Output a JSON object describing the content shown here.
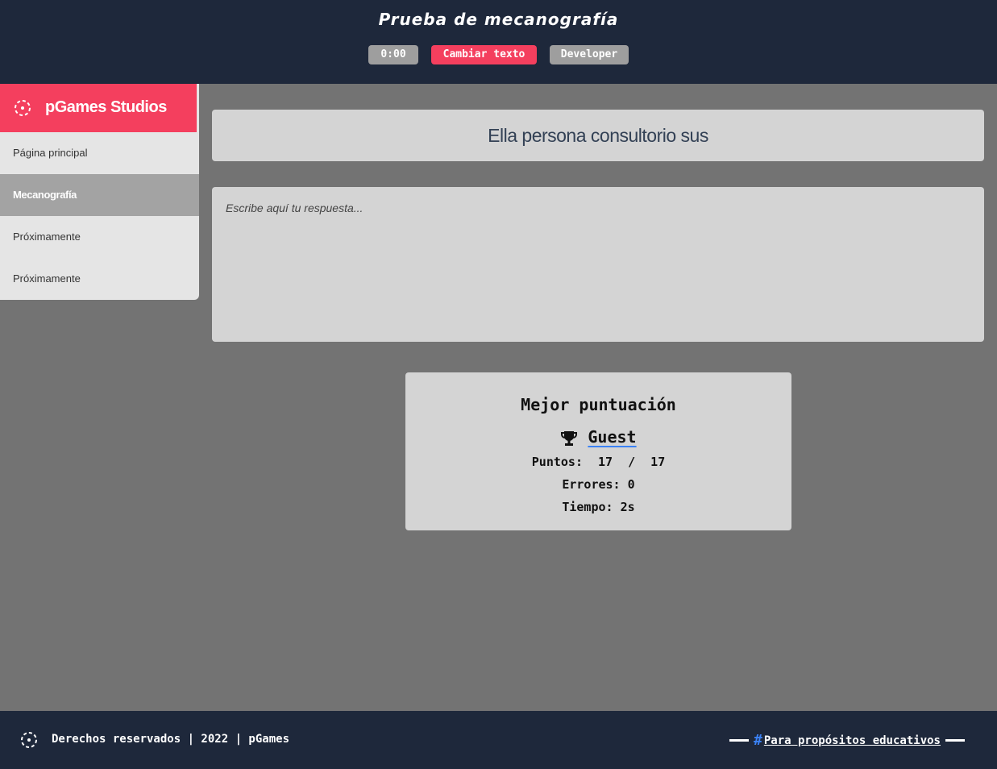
{
  "header": {
    "title": "Prueba de mecanografía",
    "timer": "0:00",
    "change_text_label": "Cambiar texto",
    "developer_label": "Developer"
  },
  "sidebar": {
    "brand": "pGames Studios",
    "items": [
      {
        "label": "Página principal",
        "active": false
      },
      {
        "label": "Mecanografía",
        "active": true
      },
      {
        "label": "Próximamente",
        "active": false
      },
      {
        "label": "Próximamente",
        "active": false
      }
    ]
  },
  "main": {
    "target_text": "Ella persona consultorio sus",
    "answer_placeholder": "Escribe aquí tu respuesta...",
    "answer_value": ""
  },
  "score": {
    "title": "Mejor puntuación",
    "user": "Guest",
    "points_label": "Puntos:",
    "points_value": "17",
    "points_sep": "/",
    "points_total": "17",
    "errors_label": "Errores:",
    "errors_value": "0",
    "time_label": "Tiempo:",
    "time_value": "2s"
  },
  "footer": {
    "copyright": "Derechos reservados | 2022 | pGames",
    "hash": "#",
    "edu_link": "Para propósitos educativos"
  },
  "colors": {
    "header_bg": "#1e283b",
    "accent": "#f43f5e",
    "gray_button": "#9e9e9e",
    "page_bg": "#737373",
    "panel_bg": "#d4d4d4",
    "link_blue": "#3b82f6"
  },
  "icons": {
    "brand": "dashed-circle-icon",
    "trophy": "trophy-icon",
    "footer": "dashed-circle-icon"
  }
}
